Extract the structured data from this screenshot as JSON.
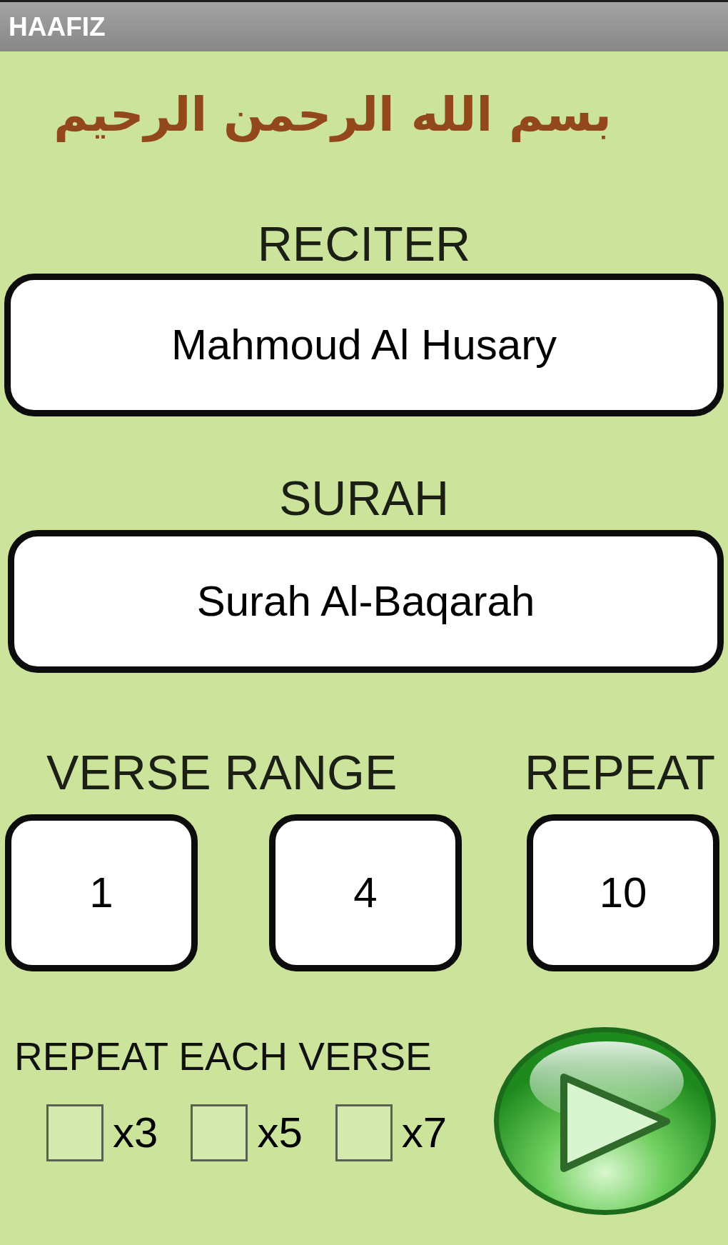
{
  "app_bar": {
    "title": "HAAFIZ"
  },
  "header": {
    "calligraphy": "بسم الله الرحمن الرحيم"
  },
  "reciter": {
    "label": "RECITER",
    "value": "Mahmoud Al Husary"
  },
  "surah": {
    "label": "SURAH",
    "value": "Surah Al-Baqarah"
  },
  "verse_range": {
    "label": "VERSE RANGE",
    "from": "1",
    "to": "4"
  },
  "repeat": {
    "label": "REPEAT",
    "value": "10"
  },
  "repeat_each_verse": {
    "label": "REPEAT EACH VERSE",
    "options": [
      {
        "label": "x3",
        "checked": false
      },
      {
        "label": "x5",
        "checked": false
      },
      {
        "label": "x7",
        "checked": false
      }
    ]
  }
}
